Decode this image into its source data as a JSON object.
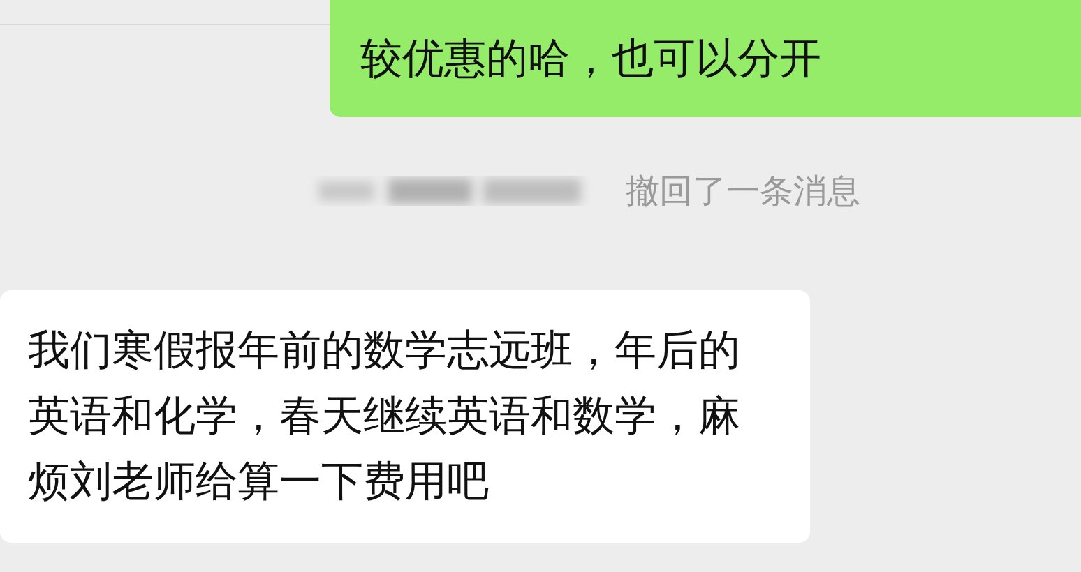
{
  "messages": [
    {
      "kind": "sent",
      "text": "较优惠的哈，也可以分开"
    },
    {
      "kind": "recall",
      "text": "撤回了一条消息"
    },
    {
      "kind": "received",
      "text": "我们寒假报年前的数学志远班，年后的英语和化学，春天继续英语和数学，麻烦刘老师给算一下费用吧"
    }
  ]
}
